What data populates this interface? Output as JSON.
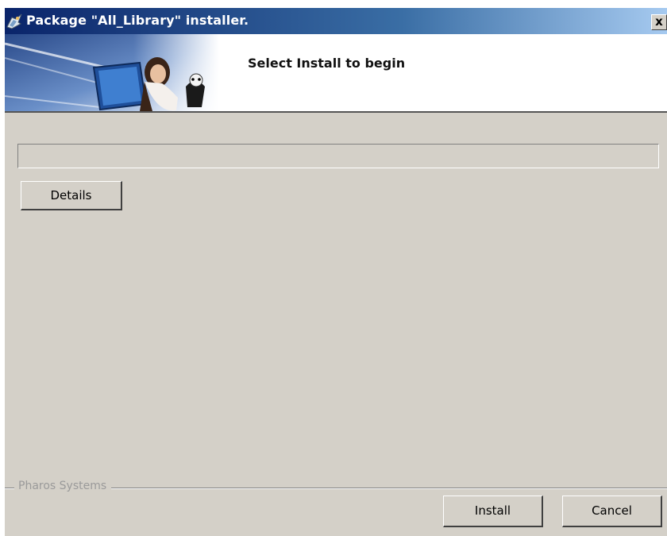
{
  "window": {
    "title": "Package \"All_Library\" installer.",
    "close_label": "x"
  },
  "header": {
    "instruction": "Select Install to begin"
  },
  "progress": {
    "value": 0
  },
  "buttons": {
    "details": "Details",
    "install": "Install",
    "cancel": "Cancel"
  },
  "footer": {
    "brand": "Pharos Systems"
  },
  "icons": {
    "app": "installer-app-icon",
    "banner": "banner-image",
    "close": "close-icon"
  },
  "colors": {
    "titlebar_start": "#0a246a",
    "titlebar_end": "#a6caf0",
    "dialog_background": "#d4d0c8",
    "header_background": "#ffffff"
  }
}
